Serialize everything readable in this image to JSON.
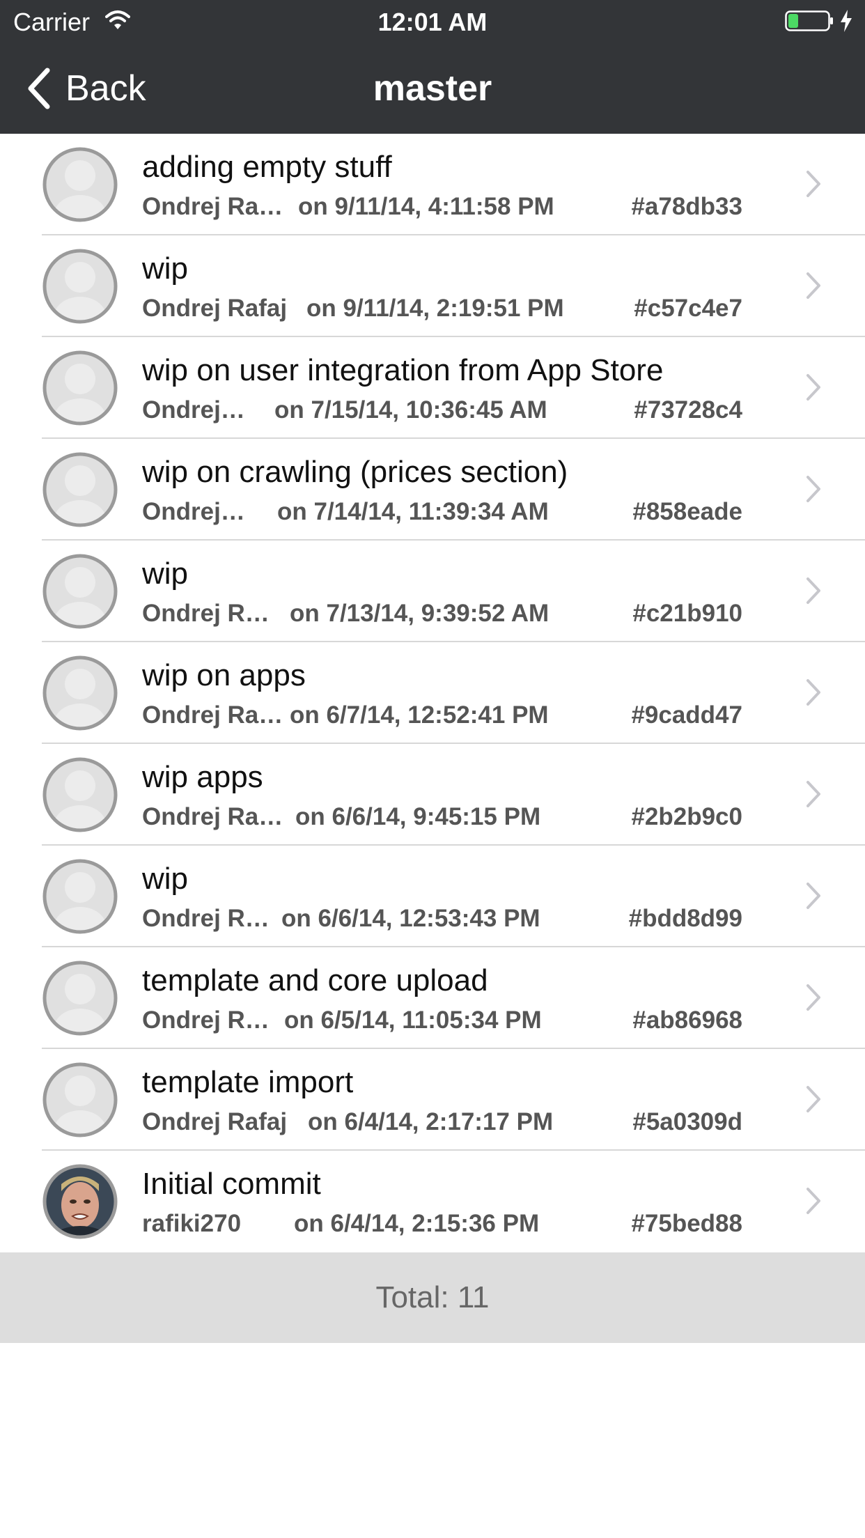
{
  "status_bar": {
    "carrier": "Carrier",
    "time": "12:01 AM",
    "battery_color": "#4cd964"
  },
  "nav": {
    "back_label": "Back",
    "title": "master",
    "background": "#333538"
  },
  "commits": [
    {
      "message": "adding empty stuff",
      "author": "Ondrej Ra…",
      "date": "on 9/11/14, 4:11:58 PM",
      "hash": "#a78db33",
      "avatar": "placeholder-avatar-icon"
    },
    {
      "message": "wip",
      "author": "Ondrej Rafaj",
      "date": "on 9/11/14, 2:19:51 PM",
      "hash": "#c57c4e7",
      "avatar": "placeholder-avatar-icon"
    },
    {
      "message": "wip on user integration from App Store",
      "author": "Ondrej…",
      "date": "on 7/15/14, 10:36:45 AM",
      "hash": "#73728c4",
      "avatar": "placeholder-avatar-icon"
    },
    {
      "message": "wip on crawling (prices section)",
      "author": "Ondrej…",
      "date": "on 7/14/14, 11:39:34 AM",
      "hash": "#858eade",
      "avatar": "placeholder-avatar-icon"
    },
    {
      "message": "wip",
      "author": "Ondrej R…",
      "date": "on 7/13/14, 9:39:52 AM",
      "hash": "#c21b910",
      "avatar": "placeholder-avatar-icon"
    },
    {
      "message": "wip on apps",
      "author": "Ondrej Ra…",
      "date": "on 6/7/14, 12:52:41 PM",
      "hash": "#9cadd47",
      "avatar": "placeholder-avatar-icon"
    },
    {
      "message": "wip apps",
      "author": "Ondrej Ra…",
      "date": "on 6/6/14, 9:45:15 PM",
      "hash": "#2b2b9c0",
      "avatar": "placeholder-avatar-icon"
    },
    {
      "message": "wip",
      "author": "Ondrej R…",
      "date": "on 6/6/14, 12:53:43 PM",
      "hash": "#bdd8d99",
      "avatar": "placeholder-avatar-icon"
    },
    {
      "message": "template and core upload",
      "author": "Ondrej R…",
      "date": "on 6/5/14, 11:05:34 PM",
      "hash": "#ab86968",
      "avatar": "placeholder-avatar-icon"
    },
    {
      "message": "template import",
      "author": "Ondrej Rafaj",
      "date": "on 6/4/14, 2:17:17 PM",
      "hash": "#5a0309d",
      "avatar": "placeholder-avatar-icon"
    },
    {
      "message": "Initial commit",
      "author": "rafiki270",
      "date": "on 6/4/14, 2:15:36 PM",
      "hash": "#75bed88",
      "avatar": "user-photo-avatar"
    }
  ],
  "footer": {
    "total": "Total: 11"
  }
}
